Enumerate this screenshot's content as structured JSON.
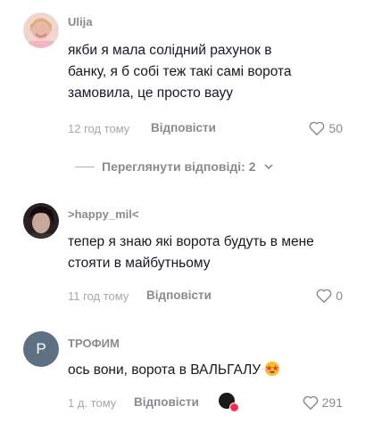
{
  "comments": [
    {
      "username": "Ulija",
      "lines": [
        "якби я мала солідний рахунок в",
        "банку, я б собі теж такі самі ворота",
        "замовила, це просто вауу"
      ],
      "time": "12 год тому",
      "reply_label": "Відповісти",
      "likes": "50"
    },
    {
      "username": ">happy_mil<",
      "lines": [
        "тепер я знаю які ворота будуть в мене",
        "стояти в майбутньому"
      ],
      "time": "11 год тому",
      "reply_label": "Відповісти",
      "likes": "0"
    },
    {
      "username": "ТРОФИМ",
      "avatar_letter": "P",
      "lines": [
        "ось вони, ворота в ВАЛЬГАЛУ"
      ],
      "time": "1 д. тому",
      "reply_label": "Відповісти",
      "likes": "291"
    }
  ],
  "view_replies_label": "Переглянути відповіді: 2",
  "colors": {
    "text": "#161823",
    "secondary": "#8a8b91",
    "avatar_letter_bg": "#5d7183"
  }
}
